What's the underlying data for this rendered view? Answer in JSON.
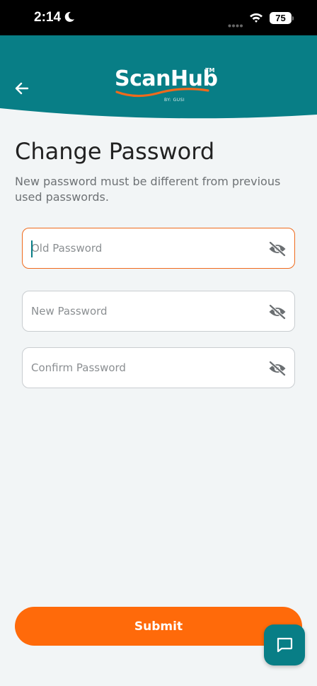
{
  "status_bar": {
    "time": "2:14",
    "battery": "75"
  },
  "header": {
    "logo_text": "ScanHub",
    "logo_tm": "TM",
    "logo_sub": "BY: GUSI"
  },
  "page": {
    "title": "Change Password",
    "subtitle": "New password must be different from previous used passwords."
  },
  "fields": {
    "old_password": {
      "placeholder": "Old Password",
      "value": ""
    },
    "new_password": {
      "placeholder": "New Password",
      "value": ""
    },
    "confirm_password": {
      "placeholder": "Confirm Password",
      "value": ""
    }
  },
  "actions": {
    "submit_label": "Submit"
  },
  "colors": {
    "header": "#087e86",
    "accent": "#ff6a0a",
    "focus_border": "#ef6a1c"
  },
  "icons": [
    "back-arrow-icon",
    "eye-off-icon",
    "chat-icon",
    "moon-icon",
    "wifi-icon"
  ]
}
